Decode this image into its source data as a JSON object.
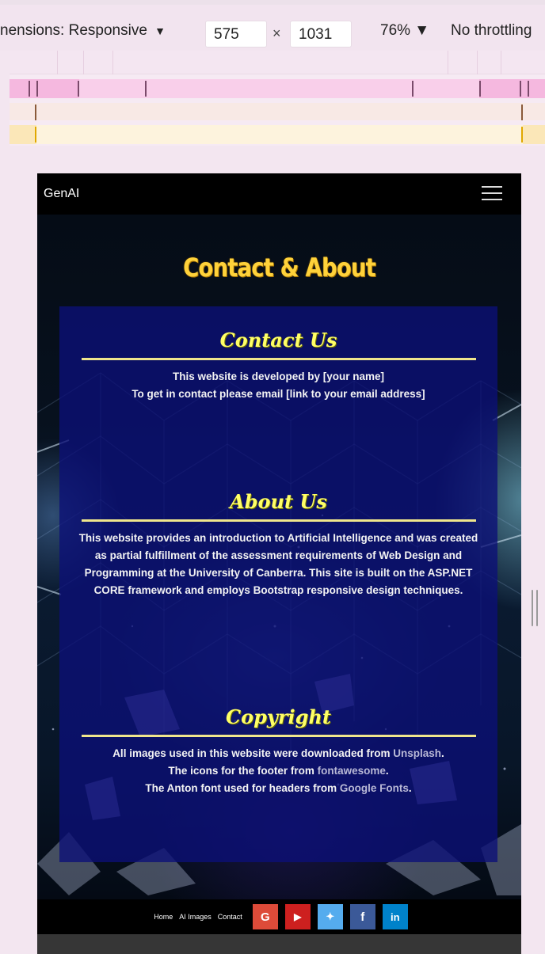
{
  "devtools": {
    "dimensions_label": "nensions: Responsive",
    "dropdown_arrow": "▼",
    "width": "575",
    "times": "×",
    "height": "1031",
    "zoom": "76% ▼",
    "throttling": "No throttling"
  },
  "navbar": {
    "brand": "GenAI",
    "menu_icon": "hamburger-icon"
  },
  "page": {
    "title": "Contact & About"
  },
  "sections": {
    "contact": {
      "title": "Contact Us",
      "lines": [
        "This website is developed by [your name]",
        "To get in contact please email [link to your email address]"
      ]
    },
    "about": {
      "title": "About Us",
      "text": "This website provides an introduction to Artificial Intelligence and was created as partial fulfillment of the assessment requirements of Web Design and Programming at the University of Canberra. This site is built on the ASP.NET CORE framework and employs Bootstrap responsive design techniques."
    },
    "copyright": {
      "title": "Copyright",
      "line1_prefix": "All images used in this website were downloaded from ",
      "line1_link": "Unsplash",
      "line1_suffix": ".",
      "line2_prefix": "The icons for the footer from ",
      "line2_link": "fontawesome",
      "line2_suffix": ".",
      "line3_prefix": "The Anton font used for headers from ",
      "line3_link": "Google Fonts",
      "line3_suffix": "."
    }
  },
  "footer": {
    "links": [
      "Home",
      "AI Images",
      "Contact"
    ],
    "social": [
      {
        "name": "google-icon",
        "glyph": "G",
        "color": "#dd4b39"
      },
      {
        "name": "youtube-icon",
        "glyph": "▶",
        "color": "#cd201f"
      },
      {
        "name": "twitter-icon",
        "glyph": "✦",
        "color": "#55acee"
      },
      {
        "name": "facebook-icon",
        "glyph": "f",
        "color": "#3b5998"
      },
      {
        "name": "linkedin-icon",
        "glyph": "in",
        "color": "#0082ca"
      }
    ]
  },
  "colors": {
    "title": "#ffd23a",
    "section_title": "#ffff66",
    "card": "#0c1078"
  }
}
